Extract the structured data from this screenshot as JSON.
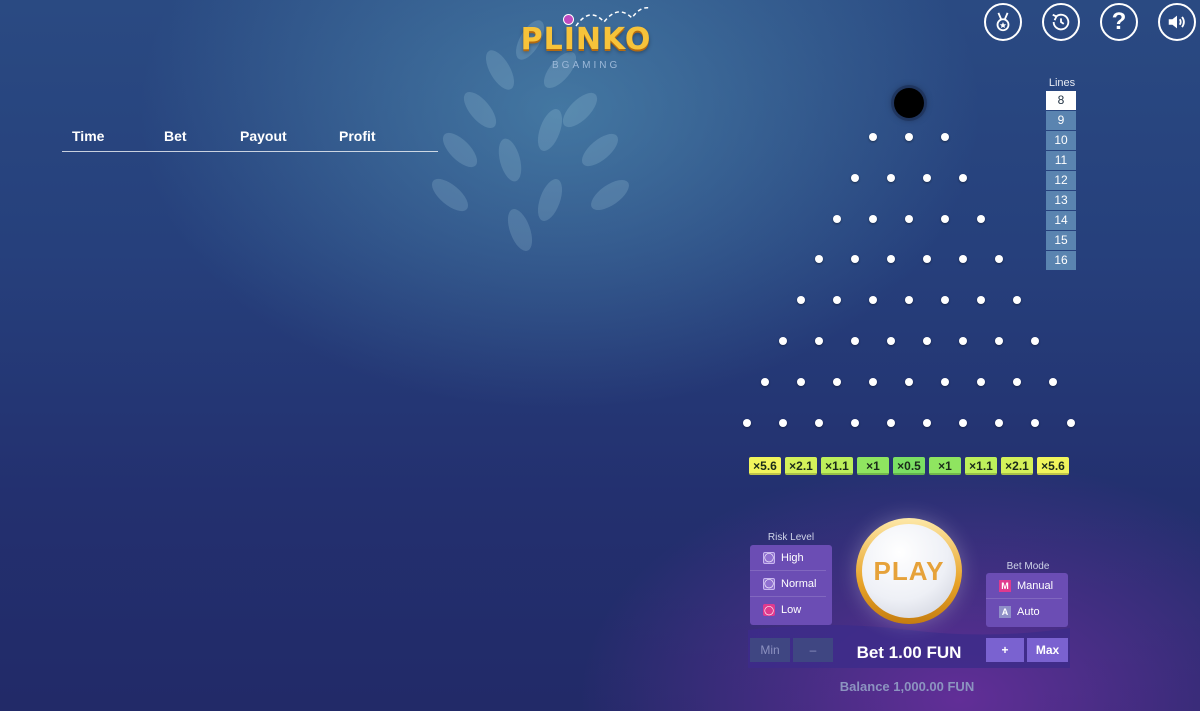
{
  "logo": {
    "title": "PLINKO",
    "subtitle": "BGAMING"
  },
  "top_buttons": [
    {
      "name": "achievements-button",
      "icon": "medal-icon"
    },
    {
      "name": "history-button",
      "icon": "history-icon"
    },
    {
      "name": "help-button",
      "icon": "help-icon",
      "glyph": "?"
    },
    {
      "name": "sound-button",
      "icon": "speaker-icon"
    }
  ],
  "history": {
    "columns": [
      "Time",
      "Bet",
      "Payout",
      "Profit"
    ],
    "rows": []
  },
  "lines": {
    "label": "Lines",
    "options": [
      "8",
      "9",
      "10",
      "11",
      "12",
      "13",
      "14",
      "15",
      "16"
    ],
    "selected": "8"
  },
  "board": {
    "rows": 8,
    "multipliers": [
      {
        "label": "×5.6",
        "color": "#f1f55c"
      },
      {
        "label": "×2.1",
        "color": "#d4f15a"
      },
      {
        "label": "×1.1",
        "color": "#bdf05b"
      },
      {
        "label": "×1",
        "color": "#8fe560"
      },
      {
        "label": "×0.5",
        "color": "#7bdf63"
      },
      {
        "label": "×1",
        "color": "#8fe560"
      },
      {
        "label": "×1.1",
        "color": "#bdf05b"
      },
      {
        "label": "×2.1",
        "color": "#d4f15a"
      },
      {
        "label": "×5.6",
        "color": "#f1f55c"
      }
    ]
  },
  "risk": {
    "label": "Risk Level",
    "options": [
      {
        "label": "High",
        "selected": false
      },
      {
        "label": "Normal",
        "selected": false
      },
      {
        "label": "Low",
        "selected": true
      }
    ]
  },
  "bet_mode": {
    "label": "Bet Mode",
    "options": [
      {
        "label": "Manual",
        "key": "M",
        "selected": true
      },
      {
        "label": "Auto",
        "key": "A",
        "selected": false
      }
    ]
  },
  "play": {
    "label": "PLAY"
  },
  "controls": {
    "min": "Min",
    "minus": "–",
    "plus": "+",
    "max": "Max"
  },
  "bet_text": "Bet 1.00 FUN",
  "balance_text": "Balance 1,000.00 FUN"
}
